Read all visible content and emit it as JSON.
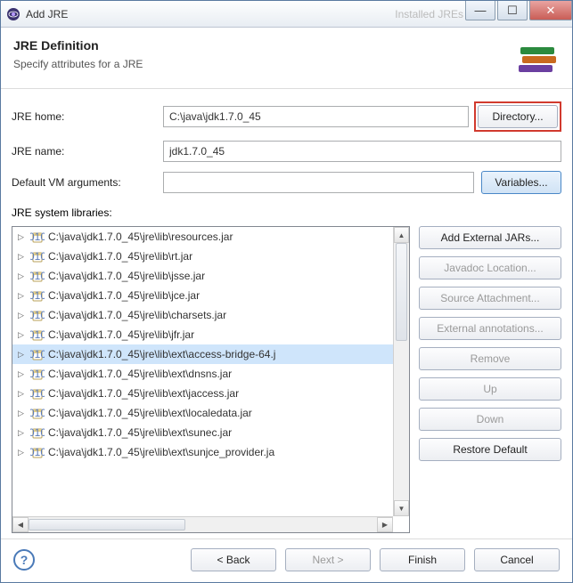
{
  "titlebar": {
    "title": "Add JRE",
    "faded": "Installed JREs"
  },
  "header": {
    "heading": "JRE Definition",
    "sub": "Specify attributes for a JRE"
  },
  "labels": {
    "jre_home": "JRE home:",
    "jre_name": "JRE name:",
    "default_vm": "Default VM arguments:",
    "sys_libs": "JRE system libraries:"
  },
  "fields": {
    "jre_home": "C:\\java\\jdk1.7.0_45",
    "jre_name": "jdk1.7.0_45",
    "default_vm": ""
  },
  "buttons": {
    "directory": "Directory...",
    "variables": "Variables...",
    "add_external": "Add External JARs...",
    "javadoc": "Javadoc Location...",
    "source": "Source Attachment...",
    "ext_annot": "External annotations...",
    "remove": "Remove",
    "up": "Up",
    "down": "Down",
    "restore": "Restore Default",
    "back": "< Back",
    "next": "Next >",
    "finish": "Finish",
    "cancel": "Cancel"
  },
  "tree": [
    {
      "path": "C:\\java\\jdk1.7.0_45\\jre\\lib\\resources.jar",
      "sel": false
    },
    {
      "path": "C:\\java\\jdk1.7.0_45\\jre\\lib\\rt.jar",
      "sel": false
    },
    {
      "path": "C:\\java\\jdk1.7.0_45\\jre\\lib\\jsse.jar",
      "sel": false
    },
    {
      "path": "C:\\java\\jdk1.7.0_45\\jre\\lib\\jce.jar",
      "sel": false
    },
    {
      "path": "C:\\java\\jdk1.7.0_45\\jre\\lib\\charsets.jar",
      "sel": false
    },
    {
      "path": "C:\\java\\jdk1.7.0_45\\jre\\lib\\jfr.jar",
      "sel": false
    },
    {
      "path": "C:\\java\\jdk1.7.0_45\\jre\\lib\\ext\\access-bridge-64.j",
      "sel": true
    },
    {
      "path": "C:\\java\\jdk1.7.0_45\\jre\\lib\\ext\\dnsns.jar",
      "sel": false
    },
    {
      "path": "C:\\java\\jdk1.7.0_45\\jre\\lib\\ext\\jaccess.jar",
      "sel": false
    },
    {
      "path": "C:\\java\\jdk1.7.0_45\\jre\\lib\\ext\\localedata.jar",
      "sel": false
    },
    {
      "path": "C:\\java\\jdk1.7.0_45\\jre\\lib\\ext\\sunec.jar",
      "sel": false
    },
    {
      "path": "C:\\java\\jdk1.7.0_45\\jre\\lib\\ext\\sunjce_provider.ja",
      "sel": false
    }
  ]
}
